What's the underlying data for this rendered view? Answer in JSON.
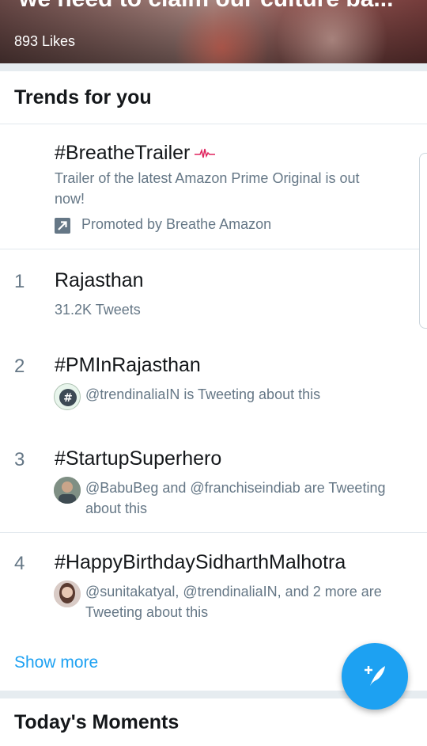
{
  "banner": {
    "title": "we need to claim our culture ba...",
    "likes": "893 Likes"
  },
  "trends": {
    "header": "Trends for you",
    "promoted": {
      "title": "#BreatheTrailer",
      "description_line1": "Trailer of the latest Amazon Prime Original is out",
      "description_line2": "now!",
      "promoted_by": "Promoted by Breathe Amazon"
    },
    "items": [
      {
        "rank": "1",
        "title": "Rajasthan",
        "meta_line1": "31.2K Tweets",
        "meta_line2": ""
      },
      {
        "rank": "2",
        "title": "#PMInRajasthan",
        "meta_line1": "@trendinaliaIN is Tweeting about this",
        "meta_line2": ""
      },
      {
        "rank": "3",
        "title": "#StartupSuperhero",
        "meta_line1": "@BabuBeg and @franchiseindiab are Tweeting",
        "meta_line2": "about this"
      },
      {
        "rank": "4",
        "title": "#HappyBirthdaySidharthMalhotra",
        "meta_line1": "@sunitakatyal, @trendinaliaIN, and 2 more are",
        "meta_line2": "Tweeting about this"
      }
    ],
    "show_more": "Show more"
  },
  "moments": {
    "title": "Today's Moments"
  },
  "icons": {
    "pulse": "heartbeat-icon",
    "promoted": "promoted-arrow-icon",
    "compose": "compose-tweet-icon"
  },
  "colors": {
    "accent": "#1da1f2",
    "text_primary": "#14171a",
    "text_secondary": "#657786",
    "pulse": "#e0245e"
  }
}
